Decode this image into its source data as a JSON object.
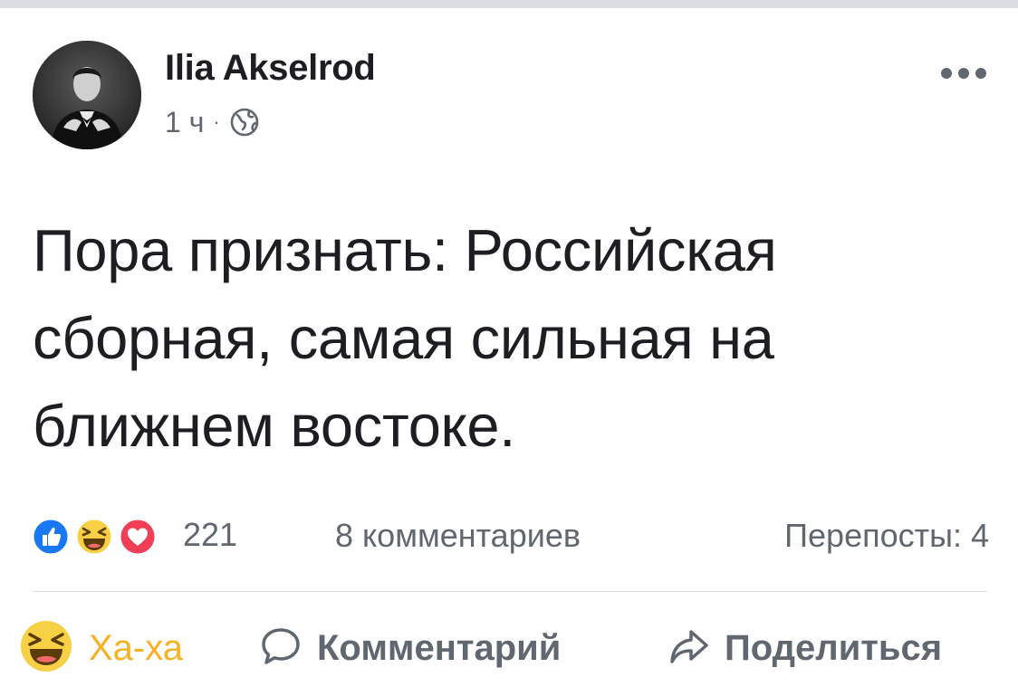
{
  "post": {
    "author": "Ilia Akselrod",
    "timestamp": "1 ч",
    "meta_separator": "·",
    "privacy_icon": "globe-icon",
    "menu_icon": "more-horizontal-icon",
    "text_lines": [
      "Пора признать: Российская",
      "сборная, самая сильная на",
      "ближнем востоке."
    ]
  },
  "stats": {
    "reaction_icons": [
      "like-reaction-icon",
      "haha-reaction-icon",
      "love-reaction-icon"
    ],
    "reactions_count": "221",
    "comments_label": "8 комментариев",
    "shares_label": "Перепосты: 4"
  },
  "actions": {
    "react_label": "Ха-ха",
    "comment_label": "Комментарий",
    "share_label": "Поделиться"
  },
  "colors": {
    "text": "#1c1e21",
    "secondary_text": "#606770",
    "like_blue": "#1877f2",
    "love_red": "#f33e58",
    "haha_yellow": "#f7b125",
    "divider": "#dadde1"
  }
}
